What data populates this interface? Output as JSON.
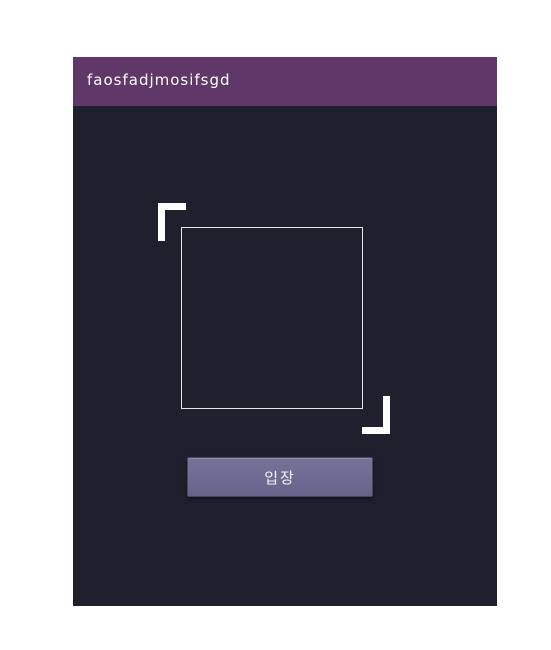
{
  "header": {
    "title": "faosfadjmosifsgd"
  },
  "main": {
    "enter_button_label": "입장"
  },
  "colors": {
    "title_bar": "#603769",
    "background": "#201f2e",
    "button": "#6f6a93",
    "frame": "#ffffff"
  },
  "icons": {
    "capture_frame": "scan-frame-icon"
  }
}
